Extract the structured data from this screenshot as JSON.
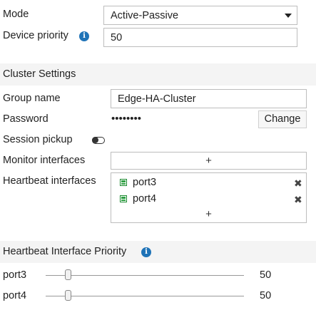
{
  "ha": {
    "mode_label": "Mode",
    "mode_value": "Active-Passive",
    "priority_label": "Device priority",
    "priority_value": "50"
  },
  "cluster": {
    "section_title": "Cluster Settings",
    "group_name_label": "Group name",
    "group_name_value": "Edge-HA-Cluster",
    "password_label": "Password",
    "password_mask": "••••••••",
    "change_label": "Change",
    "session_pickup_label": "Session pickup",
    "session_pickup_enabled": false,
    "monitor_label": "Monitor interfaces",
    "add_symbol": "+",
    "heartbeat_label": "Heartbeat interfaces",
    "heartbeat_interfaces": [
      "port3",
      "port4"
    ],
    "remove_symbol": "✖"
  },
  "priority": {
    "section_title": "Heartbeat Interface Priority",
    "rows": [
      {
        "port": "port3",
        "value": "50"
      },
      {
        "port": "port4",
        "value": "50"
      }
    ]
  },
  "icons": {
    "info": "info-circle-icon",
    "dropdown": "caret-down-icon",
    "port": "port-icon",
    "remove": "close-icon",
    "toggle": "toggle-off-icon"
  },
  "colors": {
    "info_icon": "#1f73b7",
    "port_icon": "#2ea043",
    "section_band": "#f4f4f4",
    "field_border": "#bdbdbd"
  }
}
